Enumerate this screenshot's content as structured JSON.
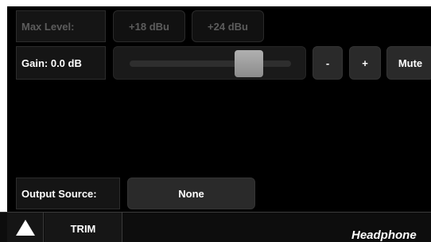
{
  "max_level": {
    "label": "Max Level:",
    "options": [
      "+18 dBu",
      "+24 dBu"
    ]
  },
  "gain": {
    "label": "Gain: 0.0 dB",
    "slider_value_fraction": 0.74,
    "minus_label": "-",
    "plus_label": "+",
    "mute_label": "Mute"
  },
  "output_source": {
    "label": "Output Source:",
    "value": "None"
  },
  "footer": {
    "home_icon": "triangle-up-icon",
    "tab_label": "TRIM",
    "title": "Headphone"
  },
  "colors": {
    "background": "#000000",
    "dim_text": "#5c5c5c",
    "thumb": "#a0a0a0"
  }
}
